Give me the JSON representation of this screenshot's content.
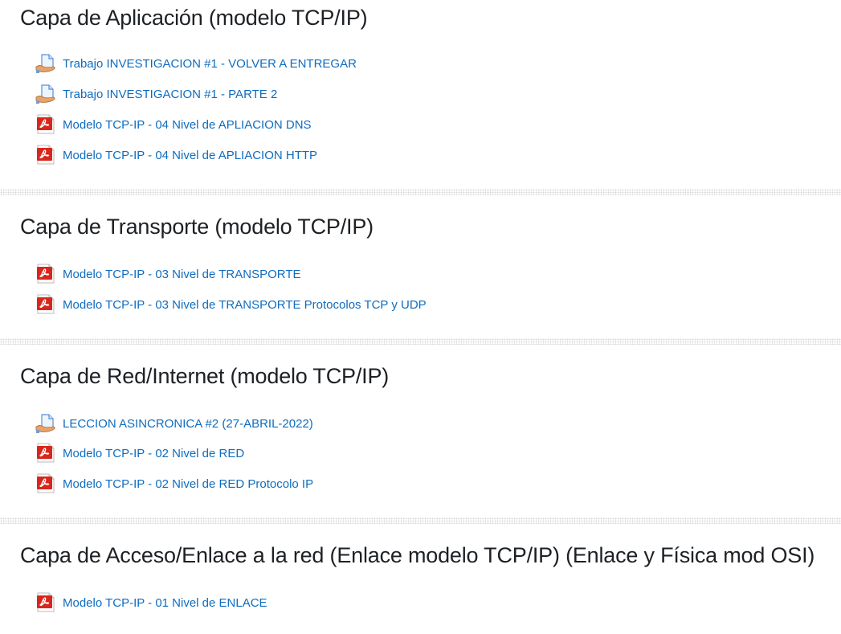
{
  "sections": [
    {
      "title": "Capa de Aplicación (modelo TCP/IP)",
      "items": [
        {
          "label": "Trabajo INVESTIGACION #1 - VOLVER A ENTREGAR",
          "icon": "assignment-icon"
        },
        {
          "label": "Trabajo INVESTIGACION #1 - PARTE 2",
          "icon": "assignment-icon"
        },
        {
          "label": "Modelo TCP-IP - 04 Nivel de APLIACION DNS",
          "icon": "pdf-icon"
        },
        {
          "label": "Modelo TCP-IP - 04 Nivel de APLIACION HTTP",
          "icon": "pdf-icon"
        }
      ]
    },
    {
      "title": "Capa de Transporte (modelo TCP/IP)",
      "items": [
        {
          "label": "Modelo TCP-IP - 03 Nivel de TRANSPORTE",
          "icon": "pdf-icon"
        },
        {
          "label": "Modelo TCP-IP - 03 Nivel de TRANSPORTE Protocolos TCP y UDP",
          "icon": "pdf-icon"
        }
      ]
    },
    {
      "title": "Capa de Red/Internet (modelo TCP/IP)",
      "items": [
        {
          "label": "LECCION ASINCRONICA #2 (27-ABRIL-2022)",
          "icon": "assignment-icon"
        },
        {
          "label": "Modelo TCP-IP - 02 Nivel de RED",
          "icon": "pdf-icon"
        },
        {
          "label": "Modelo TCP-IP - 02 Nivel de RED Protocolo IP",
          "icon": "pdf-icon"
        }
      ]
    },
    {
      "title": "Capa de Acceso/Enlace a la red (Enlace modelo TCP/IP) (Enlace y Física mod OSI)",
      "items": [
        {
          "label": "Modelo TCP-IP - 01 Nivel de ENLACE",
          "icon": "pdf-icon"
        }
      ]
    }
  ],
  "colors": {
    "link": "#0f6cbf",
    "heading": "#1d2125",
    "pdf_red": "#d9261c",
    "assignment_hand": "#e8a36a",
    "assignment_doc": "#5b8fd6"
  }
}
